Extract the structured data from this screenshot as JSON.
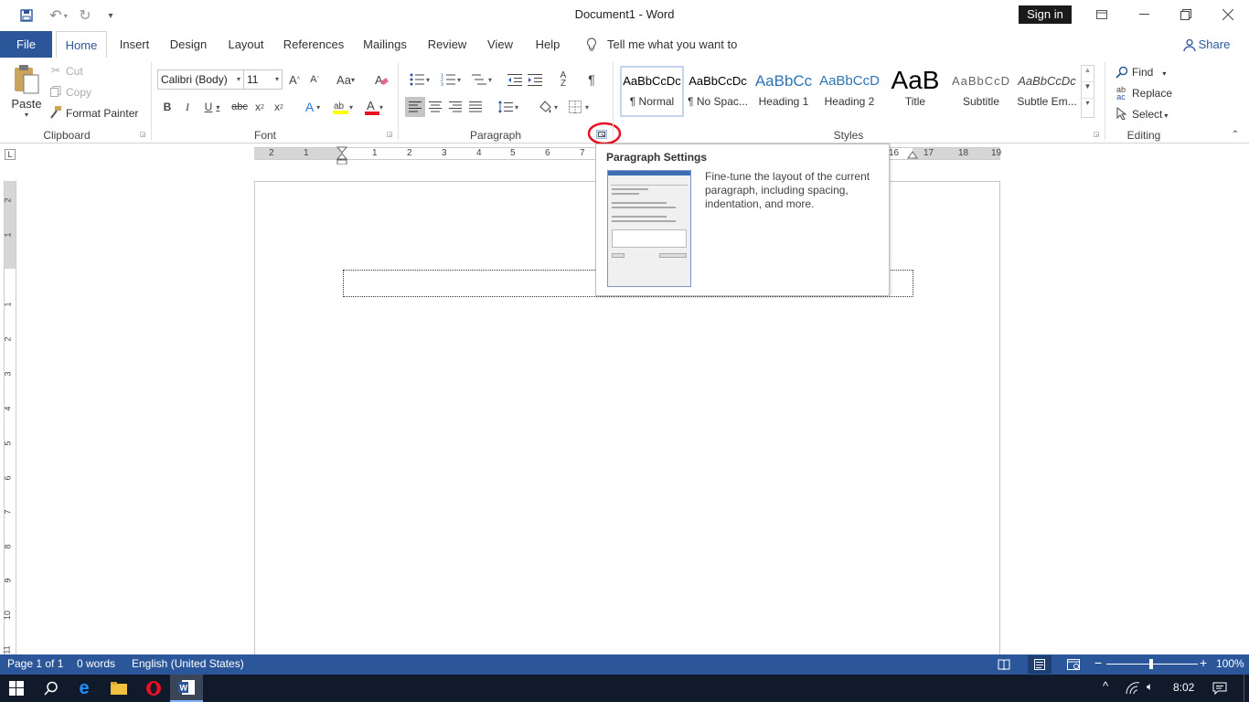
{
  "titlebar": {
    "title": "Document1 - Word",
    "sign_in": "Sign in"
  },
  "tabs": [
    "File",
    "Home",
    "Insert",
    "Design",
    "Layout",
    "References",
    "Mailings",
    "Review",
    "View",
    "Help"
  ],
  "tell_me": "Tell me what you want to do",
  "share": "Share",
  "clipboard": {
    "paste": "Paste",
    "cut": "Cut",
    "copy": "Copy",
    "format_painter": "Format Painter",
    "label": "Clipboard"
  },
  "font": {
    "name": "Calibri (Body)",
    "size": "11",
    "label": "Font"
  },
  "paragraph": {
    "label": "Paragraph"
  },
  "styles": {
    "label": "Styles",
    "items": [
      {
        "sample": "AaBbCcDc",
        "name": "¶ Normal"
      },
      {
        "sample": "AaBbCcDc",
        "name": "¶ No Spac..."
      },
      {
        "sample": "AaBbCc",
        "name": "Heading 1"
      },
      {
        "sample": "AaBbCcD",
        "name": "Heading 2"
      },
      {
        "sample": "AaB",
        "name": "Title"
      },
      {
        "sample": "AaBbCcD",
        "name": "Subtitle"
      },
      {
        "sample": "AaBbCcDc",
        "name": "Subtle Em..."
      }
    ]
  },
  "editing": {
    "find": "Find",
    "replace": "Replace",
    "select": "Select",
    "label": "Editing"
  },
  "tooltip": {
    "title": "Paragraph Settings",
    "body": "Fine-tune the layout of the current paragraph, including spacing, indentation, and more."
  },
  "ruler": {
    "h_numbers": [
      "2",
      "1",
      "1",
      "2",
      "3",
      "4",
      "5",
      "6",
      "7",
      "16",
      "17",
      "18",
      "19"
    ],
    "v_numbers": [
      "2",
      "1",
      "1",
      "2",
      "3",
      "4",
      "5",
      "6",
      "7",
      "8",
      "9",
      "10",
      "11"
    ]
  },
  "status": {
    "page": "Page 1 of 1",
    "words": "0 words",
    "language": "English (United States)",
    "zoom": "100%"
  },
  "taskbar": {
    "time": "8:02"
  },
  "colors": {
    "accent": "#2b579a",
    "taskbar": "#101a2b",
    "highlight_circle": "#e81123"
  }
}
